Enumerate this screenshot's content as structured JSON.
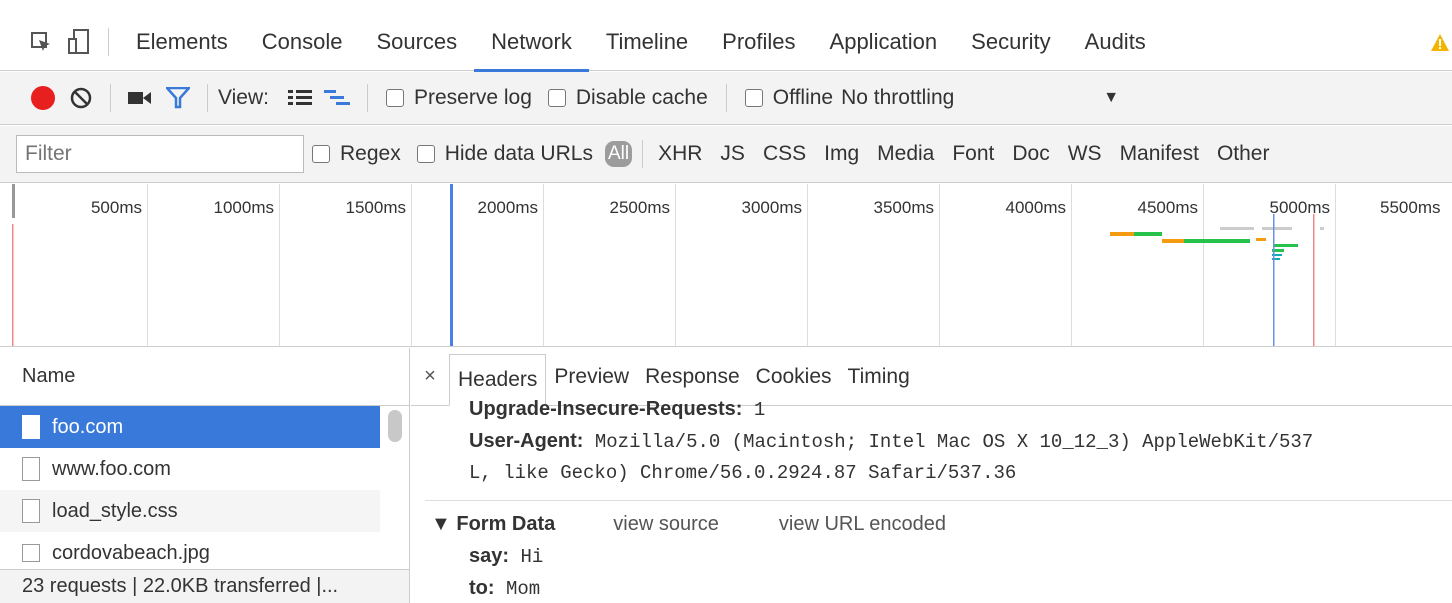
{
  "tabs": [
    "Elements",
    "Console",
    "Sources",
    "Network",
    "Timeline",
    "Profiles",
    "Application",
    "Security",
    "Audits"
  ],
  "active_tab": "Network",
  "toolbar": {
    "view_label": "View:",
    "preserve_log": "Preserve log",
    "disable_cache": "Disable cache",
    "offline": "Offline",
    "throttling": "No throttling"
  },
  "filterbar": {
    "filter_placeholder": "Filter",
    "regex": "Regex",
    "hide_data_urls": "Hide data URLs",
    "all": "All",
    "types": [
      "XHR",
      "JS",
      "CSS",
      "Img",
      "Media",
      "Font",
      "Doc",
      "WS",
      "Manifest",
      "Other"
    ]
  },
  "overview": {
    "ticks": [
      "500ms",
      "1000ms",
      "1500ms",
      "2000ms",
      "2500ms",
      "3000ms",
      "3500ms",
      "4000ms",
      "4500ms",
      "5000ms",
      "5500ms"
    ]
  },
  "requests": {
    "header": "Name",
    "items": [
      "foo.com",
      "www.foo.com",
      "load_style.css",
      "cordovabeach.jpg"
    ],
    "status": "23 requests | 22.0KB transferred |..."
  },
  "details": {
    "close": "×",
    "tabs": [
      "Headers",
      "Preview",
      "Response",
      "Cookies",
      "Timing"
    ],
    "headers": [
      {
        "key": "Upgrade-Insecure-Requests:",
        "value": "1"
      },
      {
        "key": "User-Agent:",
        "value": "Mozilla/5.0 (Macintosh; Intel Mac OS X 10_12_3) AppleWebKit/537"
      }
    ],
    "ua_cont": "L, like Gecko) Chrome/56.0.2924.87 Safari/537.36",
    "form_data_title": "▼ Form Data",
    "view_source": "view source",
    "view_url_encoded": "view URL encoded",
    "form_fields": [
      {
        "key": "say:",
        "value": "Hi"
      },
      {
        "key": "to:",
        "value": "Mom"
      }
    ]
  },
  "colors": {
    "accent": "#3879d9",
    "record": "#e81f1f",
    "filter": "#3879d9",
    "warning": "#f2b600"
  }
}
